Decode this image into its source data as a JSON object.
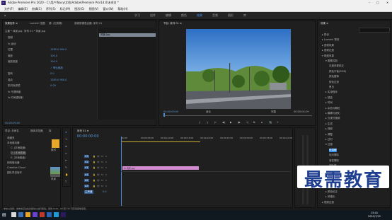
{
  "window": {
    "title": "Adobe Premiere Pro 2020 - C:\\用户\\Navy\\文档\\Adobe\\Premiere Pro\\14.0\\未命名 *"
  },
  "menu": [
    "文件(F)",
    "编辑(E)",
    "剪辑(C)",
    "序列(S)",
    "标记(M)",
    "图形(G)",
    "视图(V)",
    "窗口(W)",
    "帮助(H)"
  ],
  "workspace_tabs": [
    "学习",
    "组件",
    "编辑",
    "颜色",
    "效果",
    "音频",
    "图形",
    "库"
  ],
  "effect_controls": {
    "tabs": [
      "效果控件 ≡",
      "Lumetri 范围",
      "源: (无剪辑)",
      "音频剪辑混合器: 序列 01"
    ],
    "source_label": "主要 * 风景.jpg",
    "sequence_label": "序列 01 * 风景.jpg",
    "rows": [
      {
        "label": "视频",
        "value": ""
      },
      {
        "label": "fx 运动",
        "value": ""
      },
      {
        "label": "位置",
        "value": "1280.0   960.0"
      },
      {
        "label": "缩放",
        "value": "100.0"
      },
      {
        "label": "缩放宽度",
        "value": "100.0"
      },
      {
        "label": "",
        "value": "✓ 等比缩放"
      },
      {
        "label": "旋转",
        "value": "0.0"
      },
      {
        "label": "锚点",
        "value": "1280.0   960.0"
      },
      {
        "label": "防闪烁滤镜",
        "value": "0.00"
      },
      {
        "label": "fx 不透明度",
        "value": ""
      },
      {
        "label": "fx 时间重映射",
        "value": ""
      }
    ],
    "clip_name": "风景.jpg",
    "timecode": "00:00:00:00"
  },
  "program_monitor": {
    "title": "节目: 序列 01 ≡",
    "timecode": "00:00:00:00",
    "fit": "适合",
    "ratio": "完整",
    "duration": "00:00:04:29"
  },
  "effects_panel": {
    "title": "效果 ≡",
    "items": [
      {
        "label": "▸ 预设",
        "indent": 0
      },
      {
        "label": "▸ Lumetri 预设",
        "indent": 0
      },
      {
        "label": "▸ 音频效果",
        "indent": 0
      },
      {
        "label": "▸ 音频过渡",
        "indent": 0
      },
      {
        "label": "▾ 视频效果",
        "indent": 0
      },
      {
        "label": "▾ 图像控制",
        "indent": 1
      },
      {
        "label": "灰度系数校正",
        "indent": 2
      },
      {
        "label": "颜色平衡(RGB)",
        "indent": 2
      },
      {
        "label": "颜色替换",
        "indent": 2
      },
      {
        "label": "颜色过滤",
        "indent": 2
      },
      {
        "label": "黑白",
        "indent": 2
      },
      {
        "label": "▸ 实用程序",
        "indent": 1
      },
      {
        "label": "▸ 扭曲",
        "indent": 1
      },
      {
        "label": "▸ 时间",
        "indent": 1
      },
      {
        "label": "▸ 杂色与颗粒",
        "indent": 1
      },
      {
        "label": "▸ 模糊与锐化",
        "indent": 1
      },
      {
        "label": "▸ 沉浸式视频",
        "indent": 1
      },
      {
        "label": "▸ 生成",
        "indent": 1
      },
      {
        "label": "▸ 视频",
        "indent": 1
      },
      {
        "label": "▸ 调整",
        "indent": 1
      },
      {
        "label": "▸ 过时",
        "indent": 1
      },
      {
        "label": "▾ 过渡",
        "indent": 1
      },
      {
        "label": "块溶解",
        "indent": 2
      },
      {
        "label": "径向擦除",
        "indent": 2
      },
      {
        "label": "渐变擦除",
        "indent": 2
      },
      {
        "label": "百叶窗",
        "indent": 2
      },
      {
        "label": "线性擦除",
        "indent": 2
      },
      {
        "label": "▸ 透视",
        "indent": 1
      },
      {
        "label": "▸ 通道",
        "indent": 1
      },
      {
        "label": "▸ 键控",
        "indent": 1
      },
      {
        "label": "▸ 颜色校正",
        "indent": 1
      },
      {
        "label": "▸ 风格化",
        "indent": 1
      },
      {
        "label": "▸ 视频过渡",
        "indent": 0
      }
    ]
  },
  "project": {
    "tabs": [
      "项目: 未命名",
      "媒体浏览器",
      "库"
    ],
    "items": [
      "收藏夹",
      "本地驱动器",
      "C: (本地磁盘)",
      "D: (本地磁盘)",
      "E: (本地磁盘)",
      "网络驱动器",
      "Creative Cloud",
      "团队项目版本"
    ],
    "thumbs": [
      "素材",
      "风景"
    ]
  },
  "timeline": {
    "tab": "序列 01 ≡",
    "timecode": "00:00:00:00",
    "ruler": [
      "00:00",
      "00:00:05:00",
      "00:00:10:00",
      "00:00:15:00",
      "00:00:20:00",
      "00:00:25:00",
      "00:00:30:00",
      "00:00:35:00",
      "00:00:40:00"
    ],
    "tracks": [
      "V3",
      "V2",
      "V1",
      "A1",
      "A2",
      "A3",
      "主声道"
    ],
    "master_value": "0.0",
    "clip_label": "fx 风景.jpg"
  },
  "status_text": "单击以选择，或单击空白处并拖动以进行框选。使用 Shift、Alt 和 Ctrl 可获得其他选项。",
  "taskbar": {
    "time": "15:41",
    "date": "2021/7/12"
  },
  "watermark": "最需教育",
  "colors": {
    "accent": "#2d8ceb",
    "clip": "#d38ad0",
    "timecode": "#4c8fdc"
  }
}
